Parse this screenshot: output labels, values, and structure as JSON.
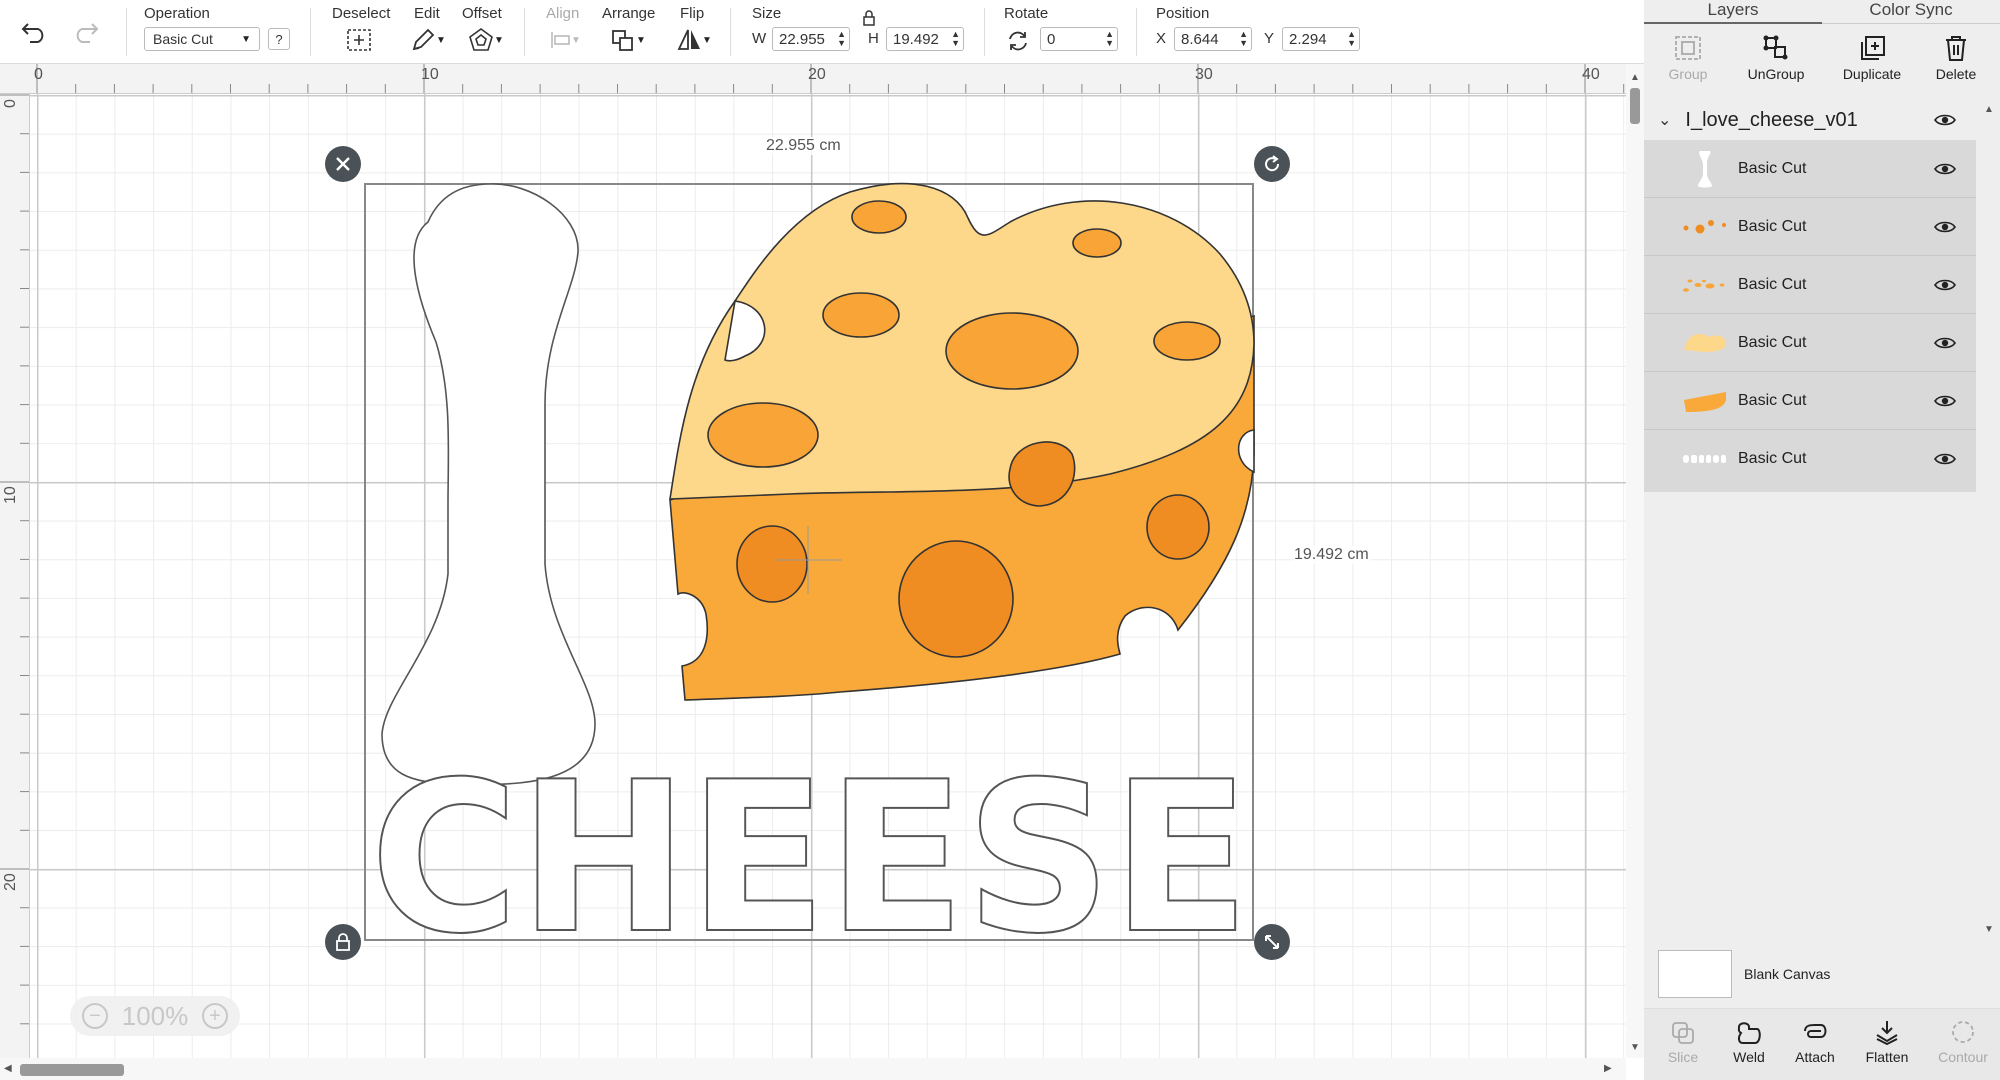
{
  "toolbar": {
    "operation_label": "Operation",
    "operation_value": "Basic Cut",
    "help": "?",
    "deselect_label": "Deselect",
    "edit_label": "Edit",
    "offset_label": "Offset",
    "align_label": "Align",
    "arrange_label": "Arrange",
    "flip_label": "Flip",
    "size_label": "Size",
    "w_label": "W",
    "w_value": "22.955",
    "h_label": "H",
    "h_value": "19.492",
    "rotate_label": "Rotate",
    "rotate_value": "0",
    "position_label": "Position",
    "x_label": "X",
    "x_value": "8.644",
    "y_label": "Y",
    "y_value": "2.294"
  },
  "rulers": {
    "top": [
      "0",
      "10",
      "20",
      "30",
      "40"
    ],
    "left": [
      "0",
      "10",
      "20"
    ]
  },
  "canvas": {
    "width_label": "22.955 cm",
    "height_label": "19.492 cm",
    "zoom": "100%",
    "design_text": "CHEESE"
  },
  "panel": {
    "tabs": [
      "Layers",
      "Color Sync"
    ],
    "actions": [
      "Group",
      "UnGroup",
      "Duplicate",
      "Delete"
    ],
    "group_name": "I_love_cheese_v01",
    "layers": [
      {
        "name": "Basic Cut",
        "thumb": "letter-i"
      },
      {
        "name": "Basic Cut",
        "thumb": "dark-dots"
      },
      {
        "name": "Basic Cut",
        "thumb": "light-dots"
      },
      {
        "name": "Basic Cut",
        "thumb": "cheese-top"
      },
      {
        "name": "Basic Cut",
        "thumb": "cheese-side"
      },
      {
        "name": "Basic Cut",
        "thumb": "cheese-word"
      }
    ],
    "blank_canvas": "Blank Canvas",
    "bottom_actions": [
      "Slice",
      "Weld",
      "Attach",
      "Flatten",
      "Contour"
    ]
  },
  "colors": {
    "cheese_top": "#fdd78a",
    "cheese_side": "#f9a93a",
    "hole_light": "#f8a436",
    "hole_dark": "#ef8c22",
    "handle": "#4a5257"
  }
}
